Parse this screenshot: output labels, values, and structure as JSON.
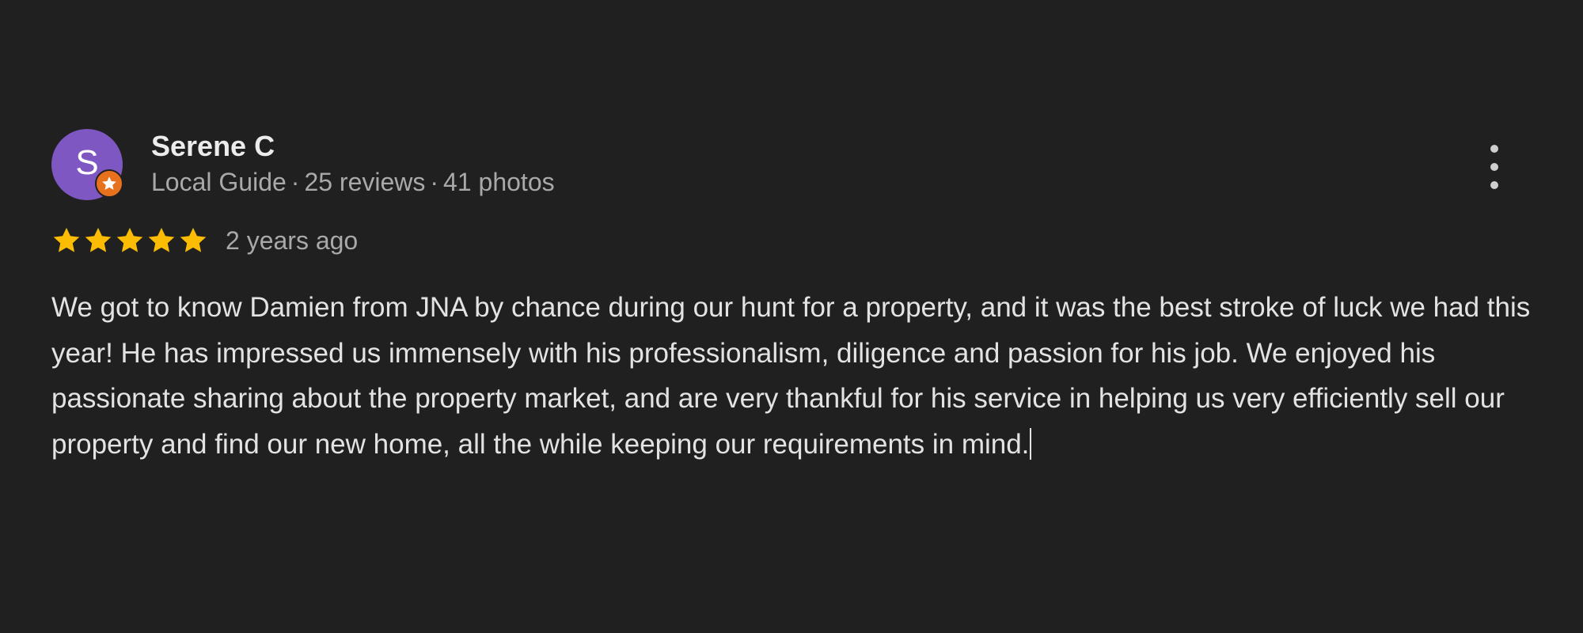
{
  "review": {
    "avatar": {
      "letter": "S",
      "color": "#7e57c2",
      "badge_icon": "local-guide-star-icon",
      "badge_color": "#e8711e"
    },
    "author_name": "Serene C",
    "meta": {
      "level": "Local Guide",
      "reviews": "25 reviews",
      "photos": "41 photos",
      "separator": "·"
    },
    "rating": {
      "stars": 5,
      "max": 5,
      "star_color": "#fbbc04",
      "star_icon": "star-icon"
    },
    "time_ago": "2 years ago",
    "text": "We got to know Damien from JNA by chance during our hunt for a property, and it was the best stroke of luck we had this year! He has impressed us immensely with his professionalism, diligence and passion for his job. We enjoyed his passionate sharing about the property market, and are very thankful for his service in helping us very efficiently sell our property and find our new home, all the while keeping our requirements in mind.",
    "more_menu_icon": "more-vert-icon"
  }
}
